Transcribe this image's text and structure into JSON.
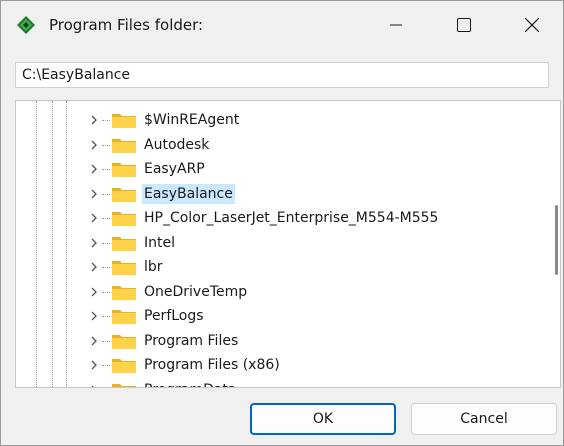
{
  "window": {
    "title": "Program Files folder:"
  },
  "path": {
    "value": "C:\\EasyBalance"
  },
  "tree": {
    "items": [
      {
        "label": "$WinREAgent",
        "selected": false
      },
      {
        "label": "Autodesk",
        "selected": false
      },
      {
        "label": "EasyARP",
        "selected": false
      },
      {
        "label": "EasyBalance",
        "selected": true
      },
      {
        "label": "HP_Color_LaserJet_Enterprise_M554-M555",
        "selected": false
      },
      {
        "label": "Intel",
        "selected": false
      },
      {
        "label": "lbr",
        "selected": false
      },
      {
        "label": "OneDriveTemp",
        "selected": false
      },
      {
        "label": "PerfLogs",
        "selected": false
      },
      {
        "label": "Program Files",
        "selected": false
      },
      {
        "label": "Program Files (x86)",
        "selected": false
      },
      {
        "label": "ProgramData",
        "selected": false
      }
    ]
  },
  "buttons": {
    "ok": "OK",
    "cancel": "Cancel"
  },
  "colors": {
    "accent": "#0067c0",
    "selection": "#cce8ff",
    "folder": "#ffd24a",
    "folder_dark": "#e8b225"
  }
}
